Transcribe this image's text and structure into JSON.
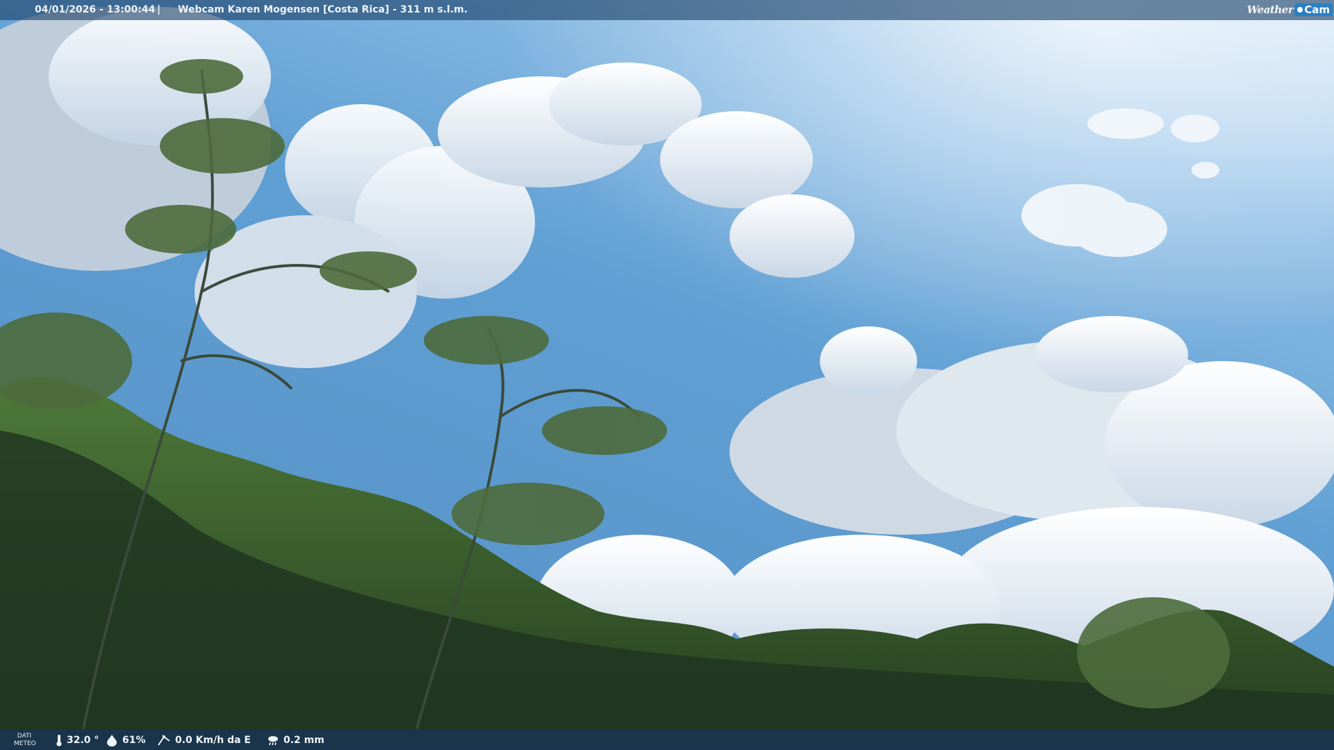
{
  "overlay": {
    "timestamp": "04/01/2026 - 13:00:44",
    "separator": "|",
    "camera_title": "Webcam Karen Mogensen [Costa Rica]  - 311 m s.l.m.",
    "brand": {
      "weather": "Weather",
      "cam": "Cam"
    }
  },
  "meteo": {
    "label_line1": "DATI",
    "label_line2": "METEO",
    "temperature": "32.0 °",
    "humidity": "61%",
    "wind": "0.0 Km/h da E",
    "rain": "0.2 mm"
  },
  "icons": {
    "temperature": "thermometer-icon",
    "humidity": "humidity-drop-icon",
    "wind": "wind-icon",
    "rain": "rain-cloud-icon"
  },
  "colors": {
    "sky": "#5f9fd3",
    "overlay": "#1c4068",
    "brand_accent": "#2a7fc4"
  }
}
